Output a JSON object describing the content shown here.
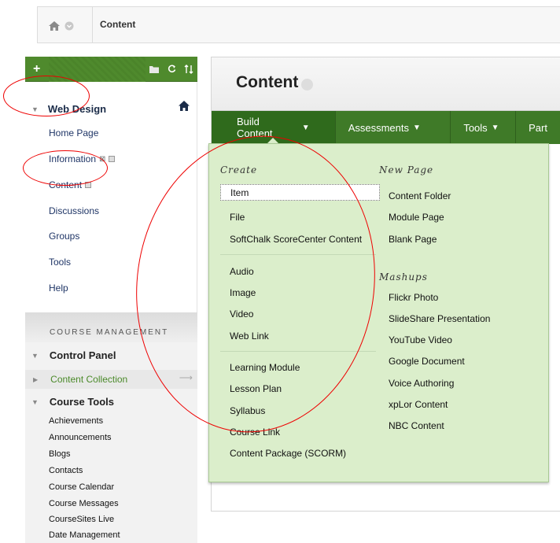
{
  "breadcrumb": {
    "current": "Content"
  },
  "course_nav": {
    "course_title": "Web Design",
    "links": [
      "Home Page",
      "Information",
      "Content",
      "Discussions",
      "Groups",
      "Tools",
      "Help"
    ]
  },
  "course_management": {
    "section_label": "COURSE MANAGEMENT",
    "control_panel": "Control Panel",
    "content_collection": "Content Collection",
    "course_tools": "Course Tools",
    "tools": [
      "Achievements",
      "Announcements",
      "Blogs",
      "Contacts",
      "Course Calendar",
      "Course Messages",
      "CourseSites Live",
      "Date Management"
    ]
  },
  "main": {
    "title": "Content",
    "menus": [
      "Build Content",
      "Assessments",
      "Tools",
      "Part"
    ]
  },
  "build_menu": {
    "create_heading": "Create",
    "create_group1": [
      "Item",
      "File",
      "SoftChalk ScoreCenter Content"
    ],
    "create_group2": [
      "Audio",
      "Image",
      "Video",
      "Web Link"
    ],
    "create_group3": [
      "Learning Module",
      "Lesson Plan",
      "Syllabus",
      "Course Link",
      "Content Package (SCORM)"
    ],
    "newpage_heading": "New Page",
    "newpage_items": [
      "Content Folder",
      "Module Page",
      "Blank Page"
    ],
    "mashups_heading": "Mashups",
    "mashups_items": [
      "Flickr Photo",
      "SlideShare Presentation",
      "YouTube Video",
      "Google Document",
      "Voice Authoring",
      "xpLor Content",
      "NBC Content"
    ]
  },
  "colors": {
    "nav_green": "#4f8a2d",
    "menu_green": "#3f7a28",
    "dropdown_bg": "#dbeecb",
    "annotation_red": "#e00000"
  }
}
